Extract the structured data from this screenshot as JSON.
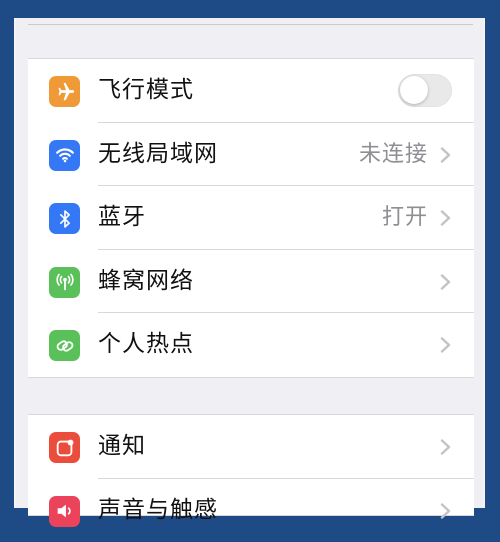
{
  "settings": {
    "group1": [
      {
        "label": "飞行模式",
        "value": "",
        "icon": "airplane-icon",
        "color": "#f09a37",
        "control": "toggle",
        "toggle_on": false
      },
      {
        "label": "无线局域网",
        "value": "未连接",
        "icon": "wifi-icon",
        "color": "#3478f6",
        "control": "chevron"
      },
      {
        "label": "蓝牙",
        "value": "打开",
        "icon": "bluetooth-icon",
        "color": "#3478f6",
        "control": "chevron"
      },
      {
        "label": "蜂窝网络",
        "value": "",
        "icon": "cellular-icon",
        "color": "#5ac05a",
        "control": "chevron"
      },
      {
        "label": "个人热点",
        "value": "",
        "icon": "hotspot-icon",
        "color": "#5ac05a",
        "control": "chevron"
      }
    ],
    "group2": [
      {
        "label": "通知",
        "value": "",
        "icon": "notifications-icon",
        "color": "#eb4d3d",
        "control": "chevron"
      },
      {
        "label": "声音与触感",
        "value": "",
        "icon": "sounds-icon",
        "color": "#eb445a",
        "control": "chevron"
      }
    ]
  }
}
